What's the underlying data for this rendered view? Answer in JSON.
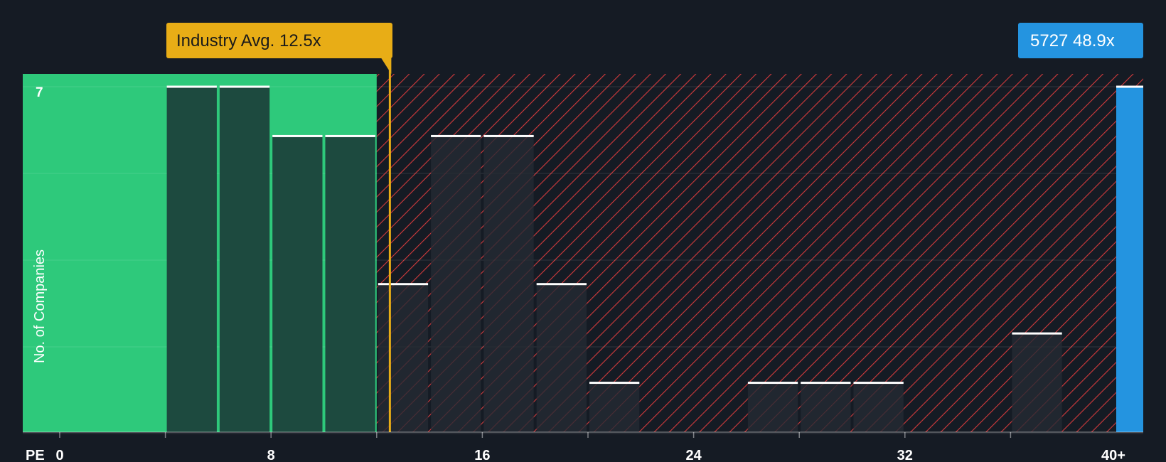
{
  "chart_data": {
    "type": "bar",
    "x_axis_label": "PE",
    "y_axis_label": "No. of Companies",
    "x_ticks": [
      {
        "value": 0,
        "label": "0"
      },
      {
        "value": 8,
        "label": "8"
      },
      {
        "value": 16,
        "label": "16"
      },
      {
        "value": 24,
        "label": "24"
      },
      {
        "value": 32,
        "label": "32"
      },
      {
        "value": 40,
        "label": "40+"
      }
    ],
    "xlim": [
      0,
      41
    ],
    "ylim": [
      0,
      7
    ],
    "y_ticks_shown": [
      {
        "value": 7,
        "label": "7"
      }
    ],
    "bin_width": 2,
    "bins": [
      {
        "start": 4,
        "count": 7
      },
      {
        "start": 6,
        "count": 7
      },
      {
        "start": 8,
        "count": 6
      },
      {
        "start": 10,
        "count": 6
      },
      {
        "start": 12,
        "count": 3
      },
      {
        "start": 14,
        "count": 6
      },
      {
        "start": 16,
        "count": 6
      },
      {
        "start": 18,
        "count": 3
      },
      {
        "start": 20,
        "count": 1
      },
      {
        "start": 26,
        "count": 1
      },
      {
        "start": 28,
        "count": 1
      },
      {
        "start": 30,
        "count": 1
      },
      {
        "start": 36,
        "count": 2
      }
    ],
    "industry_avg": {
      "value": 12.5,
      "label": "Industry Avg. 12.5x"
    },
    "company": {
      "ticker": "5727",
      "value": 48.9,
      "label": "5727 48.9x",
      "count": 7
    },
    "fair_zone_end": 12,
    "colors": {
      "background": "#151b24",
      "fair_zone": "#2ec97b",
      "bar_in_fair_zone": "#1d4a3f",
      "bar_outside": "#252a33",
      "hatch_line": "#d23a3c",
      "industry_avg": "#e8ad16",
      "company": "#2494e0",
      "bar_top": "#ffffff",
      "axis_text": "#ffffff"
    }
  }
}
